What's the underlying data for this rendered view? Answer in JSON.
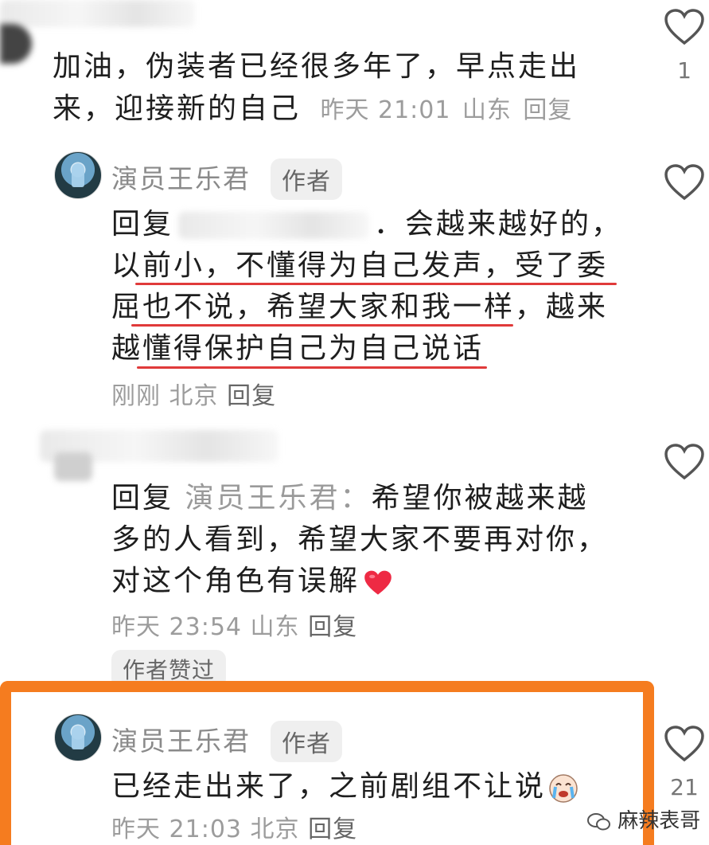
{
  "comments": [
    {
      "text_line1": "加油，伪装者已经很多年了，早点走出",
      "text_line2": "来，迎接新的自己",
      "time": "昨天 21:01",
      "location": "山东",
      "reply": "回复",
      "likes": "1"
    },
    {
      "author": "演员王乐君",
      "tag": "作者",
      "reply_prefix": "回复",
      "lines": [
        "．会越来越好的，",
        "以前小，不懂得为自己发声，受了委",
        "屈也不说，希望大家和我一样，越来",
        "越懂得保护自己为自己说话"
      ],
      "time": "刚刚",
      "location": "北京",
      "reply": "回复"
    },
    {
      "reply_prefix": "回复",
      "reply_to": "演员王乐君：",
      "line1": "希望你被越来越",
      "line2": "多的人看到，希望大家不要再对你，",
      "line3": "对这个角色有误解",
      "time": "昨天 23:54",
      "location": "山东",
      "reply": "回复",
      "badge": "作者赞过"
    },
    {
      "author": "演员王乐君",
      "tag": "作者",
      "text": "已经走出来了，之前剧组不让说",
      "time": "昨天 21:03",
      "location": "北京",
      "reply": "回复",
      "likes": "21"
    }
  ],
  "watermark": "麻辣表哥",
  "colors": {
    "highlight_box": "#f57c1f",
    "underline": "#e03a3a",
    "meta_gray": "#9c9c9c"
  }
}
